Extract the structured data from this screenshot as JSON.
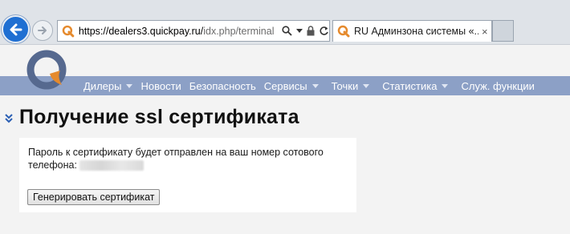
{
  "browser": {
    "url_host": "https://dealers3.quickpay.ru/",
    "url_path": "idx.php/terminal",
    "tab_title": "RU Админзона системы «...",
    "tab_close": "×"
  },
  "menu": {
    "items": [
      {
        "label": "Дилеры",
        "dropdown": true
      },
      {
        "label": "Новости",
        "dropdown": false
      },
      {
        "label": "Безопасность",
        "dropdown": false
      },
      {
        "label": "Сервисы",
        "dropdown": true
      },
      {
        "label": "Точки",
        "dropdown": true
      },
      {
        "label": "Статистика",
        "dropdown": true
      },
      {
        "label": "Служ. функции",
        "dropdown": false
      }
    ]
  },
  "content": {
    "page_title": "Получение ssl сертификата",
    "message_line1": "Пароль к сертификату будет отправлен на ваш номер сотового телефона:",
    "generate_button": "Генерировать сертификат"
  },
  "colors": {
    "menubar_bg": "#8ca0c6",
    "logo_blue": "#56698f",
    "logo_orange": "#e58a2d",
    "back_button": "#1f6fd2"
  },
  "icons": [
    "back-arrow-icon",
    "forward-arrow-icon",
    "site-favicon-icon",
    "search-icon",
    "dropdown-icon",
    "lock-icon",
    "refresh-icon",
    "collapse-chevrons-icon",
    "quickpay-logo"
  ]
}
